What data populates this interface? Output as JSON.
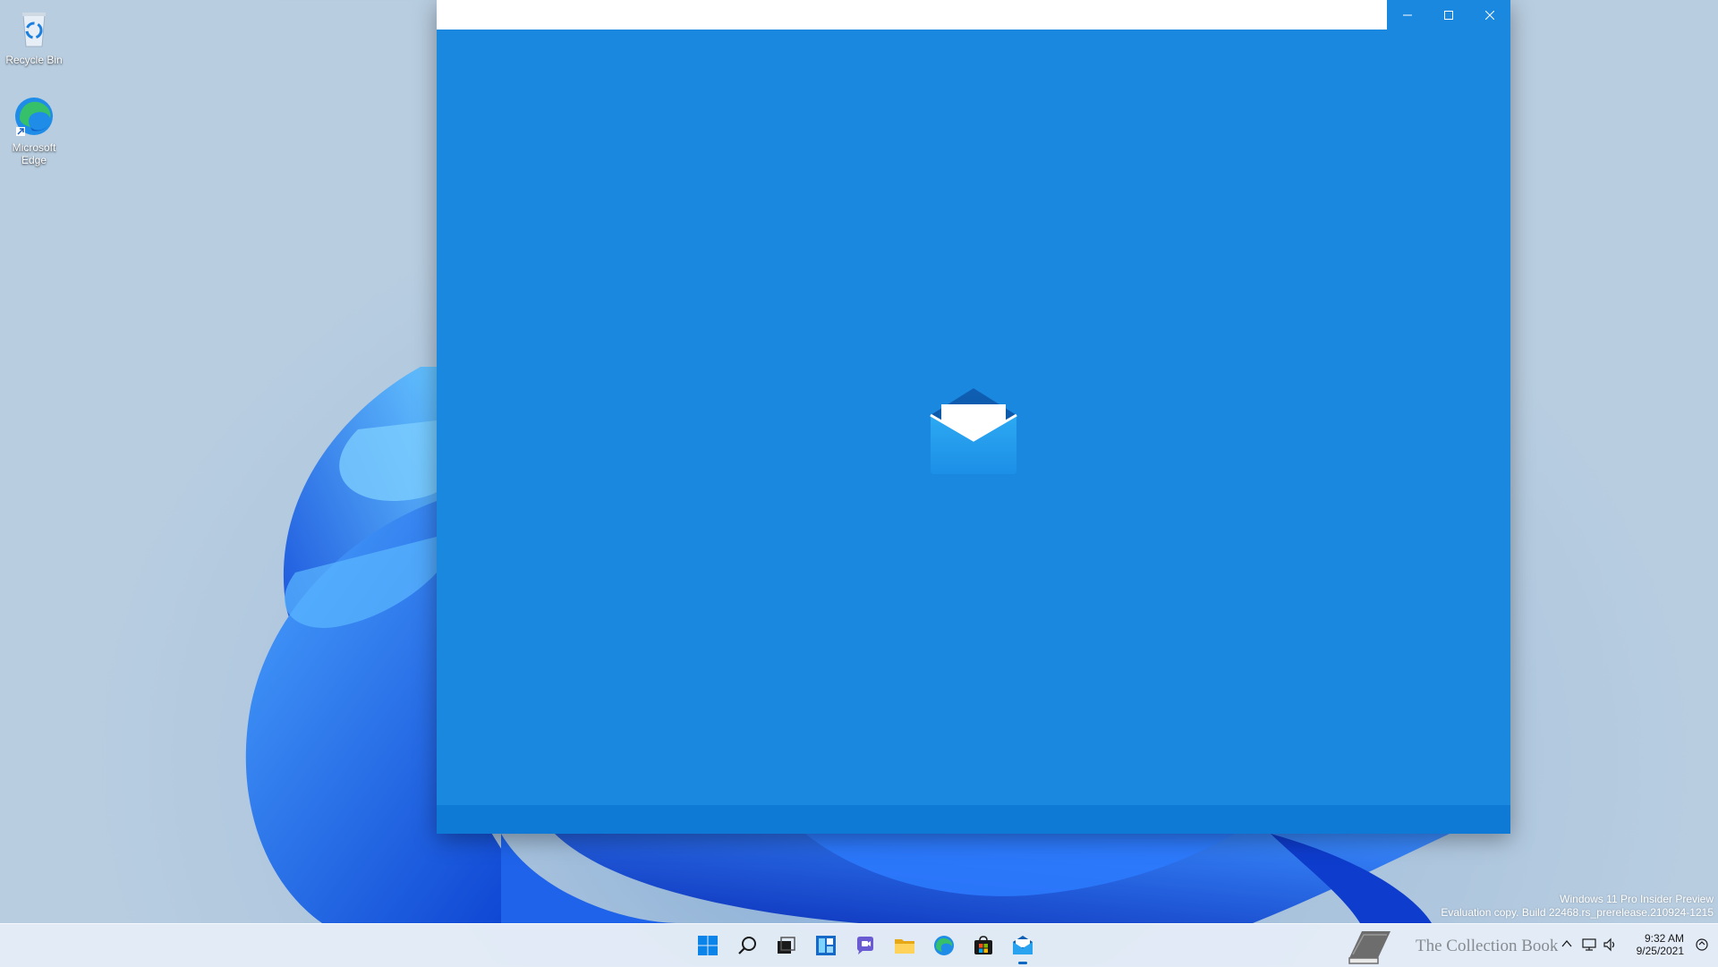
{
  "desktop": {
    "icons": [
      {
        "label": "Recycle Bin",
        "icon": "recycle-bin-icon"
      },
      {
        "label": "Microsoft Edge",
        "icon": "edge-icon"
      }
    ]
  },
  "window": {
    "title": "",
    "app_icon": "mail-icon",
    "caption": {
      "minimize": "minimize-icon",
      "maximize": "maximize-icon",
      "close": "close-icon"
    },
    "background_color": "#1b88df"
  },
  "watermark": {
    "line1": "Windows 11 Pro Insider Preview",
    "line2": "Evaluation copy. Build 22468.rs_prerelease.210924-1215"
  },
  "taskbar": {
    "items": [
      {
        "name": "start",
        "icon": "windows-start-icon"
      },
      {
        "name": "search",
        "icon": "search-icon"
      },
      {
        "name": "task-view",
        "icon": "task-view-icon"
      },
      {
        "name": "widgets",
        "icon": "widgets-icon"
      },
      {
        "name": "chat",
        "icon": "teams-chat-icon"
      },
      {
        "name": "file-explorer",
        "icon": "folder-icon"
      },
      {
        "name": "edge",
        "icon": "edge-icon"
      },
      {
        "name": "store",
        "icon": "store-icon"
      },
      {
        "name": "mail",
        "icon": "mail-icon",
        "active": true
      }
    ],
    "tray": {
      "brand_text": "The Collection Book",
      "time": "9:32 AM",
      "date": "9/25/2021"
    }
  }
}
